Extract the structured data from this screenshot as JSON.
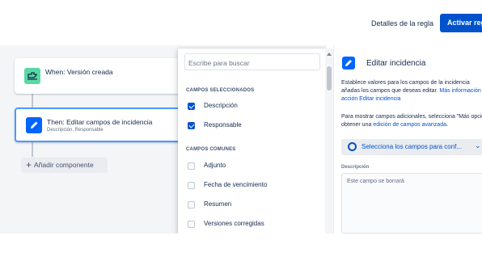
{
  "header": {
    "rule_details_label": "Detalles de la regla",
    "activate_label": "Activar regla"
  },
  "colors": {
    "primary": "#0052cc",
    "trigger_icon": "#57d9a3",
    "action_icon": "#0065ff",
    "selected_border": "#4c9aff",
    "canvas_bg": "#f4f5f7"
  },
  "flow": {
    "trigger": {
      "title": "When: Versión creada",
      "icon": "rocket-icon"
    },
    "action": {
      "title": "Then: Editar campos de incidencia",
      "subtitle": "Descripción, Responsable",
      "icon": "pencil-icon"
    },
    "add_component_label": "Añadir componente"
  },
  "field_picker": {
    "search_placeholder": "Escribe para buscar",
    "selected_header": "CAMPOS SELECCIONADOS",
    "selected": [
      {
        "label": "Descripción",
        "checked": true
      },
      {
        "label": "Responsable",
        "checked": true
      }
    ],
    "common_header": "CAMPOS COMUNES",
    "common": [
      {
        "label": "Adjunto",
        "checked": false
      },
      {
        "label": "Fecha de vencimiento",
        "checked": false
      },
      {
        "label": "Resumen",
        "checked": false
      },
      {
        "label": "Versiones corregidas",
        "checked": false
      }
    ]
  },
  "panel": {
    "title": "Editar incidencia",
    "desc_line1": "Establece valores para los campos de la incidencia",
    "desc_line2_text": "añadas los campos que deseas editar. ",
    "desc_line2_link": "Más información",
    "desc_line3_link": "acción Editar incidencia",
    "more_line1": "Para mostrar campos adicionales, selecciona \"Más opciones\"",
    "more_line2_text": "obtener una ",
    "more_line2_link": "edición de campos avanzada",
    "more_line2_end": ".",
    "select_fields_label": "Selecciona los campos para conf...",
    "description_label": "Descripción",
    "description_value": "Este campo se borrará"
  }
}
